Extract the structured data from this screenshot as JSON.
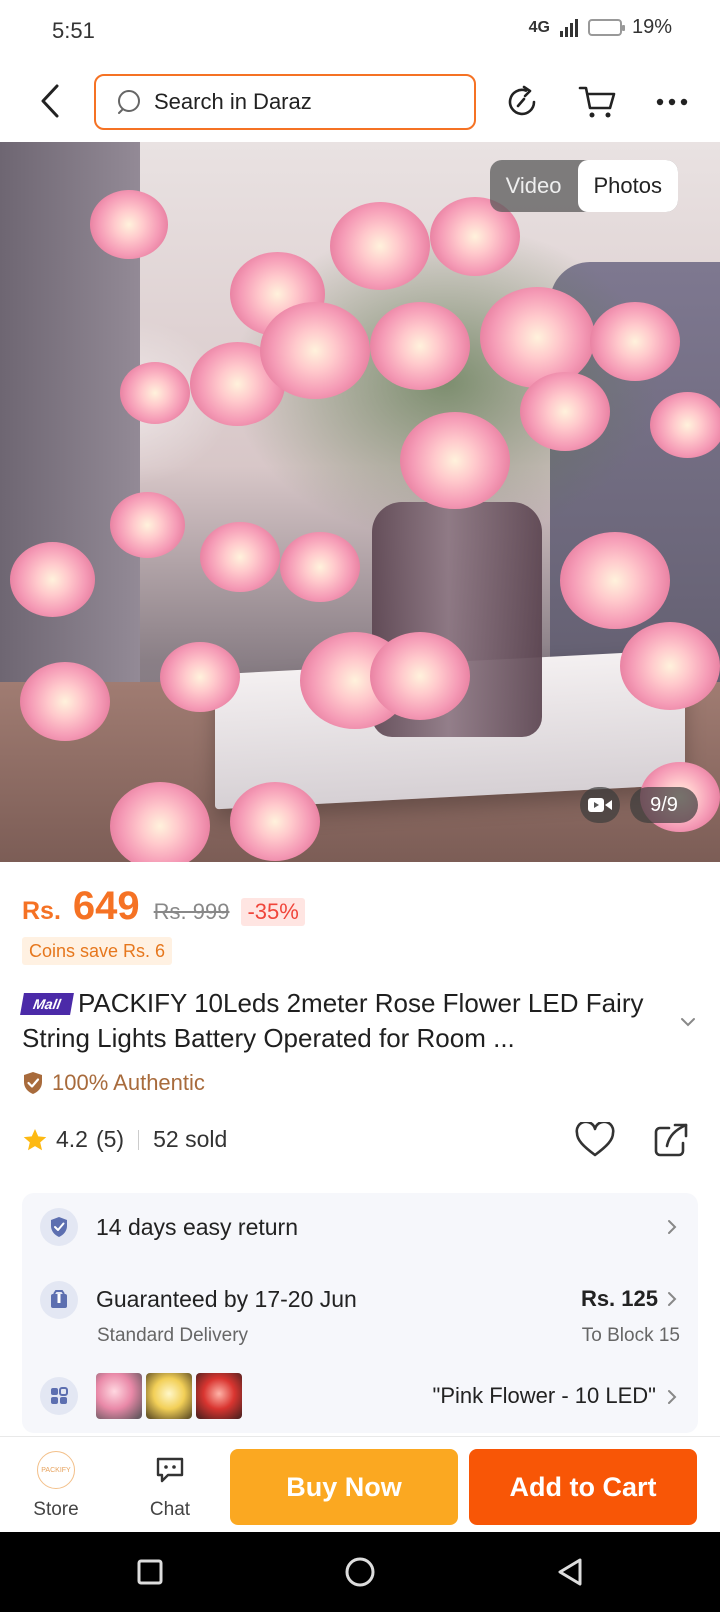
{
  "status_bar": {
    "time": "5:51",
    "network": "4G",
    "battery_percent": "19%",
    "battery_level": 0.19
  },
  "header": {
    "search_placeholder": "Search in Daraz",
    "icons": [
      "back-arrow-icon",
      "search-icon",
      "history-icon",
      "cart-icon",
      "more-icon"
    ]
  },
  "gallery": {
    "tabs": [
      {
        "label": "Video",
        "active": false
      },
      {
        "label": "Photos",
        "active": true
      }
    ],
    "counter": "9/9"
  },
  "product": {
    "currency": "Rs.",
    "price": "649",
    "original_price": "Rs. 999",
    "discount": "-35%",
    "coins_save": "Coins save Rs. 6",
    "mall_badge": "Mall",
    "title": "PACKIFY 10Leds 2meter Rose Flower LED Fairy String Lights Battery Operated for Room ...",
    "authentic": "100% Authentic",
    "rating": "4.2",
    "rating_count": "(5)",
    "sold": "52 sold"
  },
  "services": {
    "return": {
      "title": "14 days easy return"
    },
    "delivery": {
      "title": "Guaranteed by 17-20 Jun",
      "subtitle": "Standard Delivery",
      "price": "Rs. 125",
      "location": "To Block 15"
    },
    "variant": {
      "selected": "\"Pink Flower - 10 LED\""
    }
  },
  "bottom_bar": {
    "store_label": "Store",
    "store_logo_text": "PACKIFY",
    "chat_label": "Chat",
    "buy_now": "Buy Now",
    "add_to_cart": "Add to Cart"
  },
  "colors": {
    "accent": "#f57224",
    "buy_now": "#fba821",
    "add_to_cart": "#f85606",
    "mall": "#4b2aa8",
    "authentic": "#a86b3c"
  }
}
